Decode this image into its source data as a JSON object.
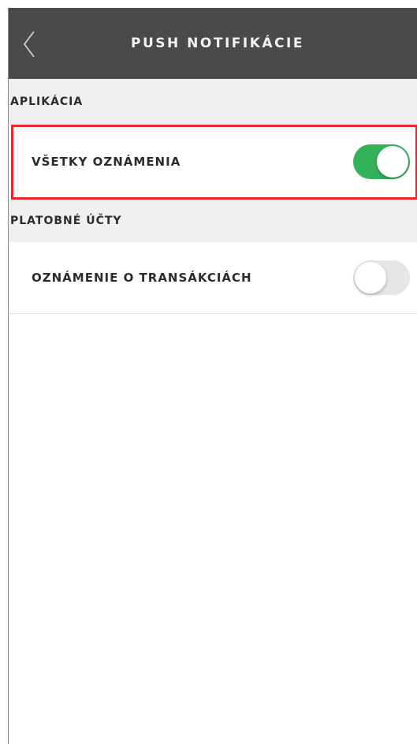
{
  "header": {
    "title": "PUSH NOTIFIKÁCIE",
    "back_icon": "chevron-left-icon"
  },
  "sections": [
    {
      "title": "APLIKÁCIA",
      "rows": [
        {
          "label": "VŠETKY OZNÁMENIA",
          "toggle_on": true
        }
      ]
    },
    {
      "title": "PLATOBNÉ ÚČTY",
      "rows": [
        {
          "label": "OZNÁMENIE O TRANSÁKCIÁCH",
          "toggle_on": false
        }
      ]
    }
  ],
  "colors": {
    "header_bg": "#4a4a4a",
    "toggle_on": "#34b25a",
    "toggle_off": "#e6e6e6",
    "highlight": "#e8282f",
    "section_bg": "#f0f0f0"
  }
}
